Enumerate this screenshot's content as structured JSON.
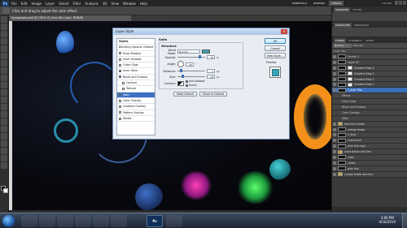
{
  "menubar": {
    "items": [
      "File",
      "Edit",
      "Image",
      "Layer",
      "Select",
      "Filter",
      "Analysis",
      "3D",
      "View",
      "Window",
      "Help"
    ],
    "workspaces": [
      "ESSENTIALS",
      "DESIGN",
      "PAINTING"
    ],
    "cs_live": "CS LIVE"
  },
  "options_bar": {
    "hint": "Click and drag to adjust the satin effect."
  },
  "document": {
    "tab_title": "typography.psd @ 100% (5_liner fills copy, RGB/8)"
  },
  "dialog": {
    "title": "Layer Style",
    "styles_list": [
      {
        "label": "Styles",
        "checkbox": false,
        "checked": false,
        "indent": false,
        "head": true,
        "active": false
      },
      {
        "label": "Blending Options: Default",
        "checkbox": false,
        "checked": false,
        "indent": false,
        "head": false,
        "active": false
      },
      {
        "label": "Drop Shadow",
        "checkbox": true,
        "checked": false,
        "indent": false,
        "head": false,
        "active": false
      },
      {
        "label": "Inner Shadow",
        "checkbox": true,
        "checked": false,
        "indent": false,
        "head": false,
        "active": false
      },
      {
        "label": "Outer Glow",
        "checkbox": true,
        "checked": false,
        "indent": false,
        "head": false,
        "active": false
      },
      {
        "label": "Inner Glow",
        "checkbox": true,
        "checked": true,
        "indent": false,
        "head": false,
        "active": false
      },
      {
        "label": "Bevel and Emboss",
        "checkbox": true,
        "checked": true,
        "indent": false,
        "head": false,
        "active": false
      },
      {
        "label": "Contour",
        "checkbox": true,
        "checked": false,
        "indent": true,
        "head": false,
        "active": false
      },
      {
        "label": "Texture",
        "checkbox": true,
        "checked": false,
        "indent": true,
        "head": false,
        "active": false
      },
      {
        "label": "Satin",
        "checkbox": true,
        "checked": true,
        "indent": false,
        "head": false,
        "active": true
      },
      {
        "label": "Color Overlay",
        "checkbox": true,
        "checked": false,
        "indent": false,
        "head": false,
        "active": false
      },
      {
        "label": "Gradient Overlay",
        "checkbox": true,
        "checked": false,
        "indent": false,
        "head": false,
        "active": false
      },
      {
        "label": "Pattern Overlay",
        "checkbox": true,
        "checked": false,
        "indent": false,
        "head": false,
        "active": false
      },
      {
        "label": "Stroke",
        "checkbox": true,
        "checked": false,
        "indent": false,
        "head": false,
        "active": false
      }
    ],
    "section_title": "Satin",
    "group_title": "Structure",
    "blend_mode_label": "Blend Mode:",
    "blend_mode_value": "Normal",
    "opacity_label": "Opacity:",
    "opacity_value": "78",
    "angle_label": "Angle:",
    "angle_value": "25",
    "distance_label": "Distance:",
    "distance_value": "7",
    "size_label": "Size:",
    "size_value": "18",
    "unit_px": "px",
    "unit_pct": "%",
    "contour_label": "Contour:",
    "anti_aliased_label": "Anti-aliased",
    "invert_label": "Invert",
    "make_default_label": "Make Default",
    "reset_default_label": "Reset to Default",
    "ok_label": "OK",
    "cancel_label": "Cancel",
    "new_style_label": "New Style...",
    "preview_label": "Preview",
    "satin_color": "#3aa3b5"
  },
  "panels": {
    "tabs_top": [
      "SWATCHES",
      "STYLES"
    ],
    "tabs_mid": [
      "CHARACTER",
      "PARAGRAPH"
    ],
    "tabs_layers": [
      "LAYERS",
      "CHANNELS",
      "PATHS"
    ],
    "blend_value": "Normal",
    "opacity_label": "Opacity:",
    "lock_label": "Lock:",
    "fill_label": "Fill:",
    "layers": [
      {
        "label": "Curves 1",
        "kind": "normal",
        "selected": false
      },
      {
        "label": "Layer 22",
        "kind": "normal",
        "selected": false
      },
      {
        "label": "Gradient Map 4",
        "kind": "mask",
        "selected": false
      },
      {
        "label": "Gradient Map 3",
        "kind": "mask",
        "selected": false
      },
      {
        "label": "Gradient Map 2",
        "kind": "mask",
        "selected": false
      },
      {
        "label": "Gradient Map 1",
        "kind": "mask",
        "selected": false
      },
      {
        "label": "5_liner fills...",
        "kind": "normal",
        "selected": true
      },
      {
        "label": "Effects",
        "kind": "effect",
        "selected": false
      },
      {
        "label": "Inner Glow",
        "kind": "effect",
        "selected": false
      },
      {
        "label": "Bevel and Emboss",
        "kind": "effect",
        "selected": false
      },
      {
        "label": "Color Overlay",
        "kind": "effect",
        "selected": false
      },
      {
        "label": "Satin",
        "kind": "effect",
        "selected": false
      },
      {
        "label": "text face shade",
        "kind": "folder",
        "selected": false
      },
      {
        "label": "orange drops",
        "kind": "normal",
        "selected": false
      },
      {
        "label": "5_liner",
        "kind": "normal",
        "selected": false
      },
      {
        "label": "crayons bt",
        "kind": "normal",
        "selected": false
      },
      {
        "label": "pink line copy",
        "kind": "normal",
        "selected": false
      },
      {
        "label": "inner ballon and line",
        "kind": "folder",
        "selected": false
      },
      {
        "label": "color",
        "kind": "normal",
        "selected": false
      },
      {
        "label": "cloths",
        "kind": "normal",
        "selected": false
      },
      {
        "label": "pink line",
        "kind": "normal",
        "selected": false
      },
      {
        "label": "crystal ballon and line",
        "kind": "folder",
        "selected": false
      }
    ]
  },
  "taskbar": {
    "buttons": [
      "",
      "",
      "",
      "",
      "",
      "",
      "Ps",
      ""
    ],
    "time": "3:06 PM",
    "date": "4/16/2010"
  }
}
